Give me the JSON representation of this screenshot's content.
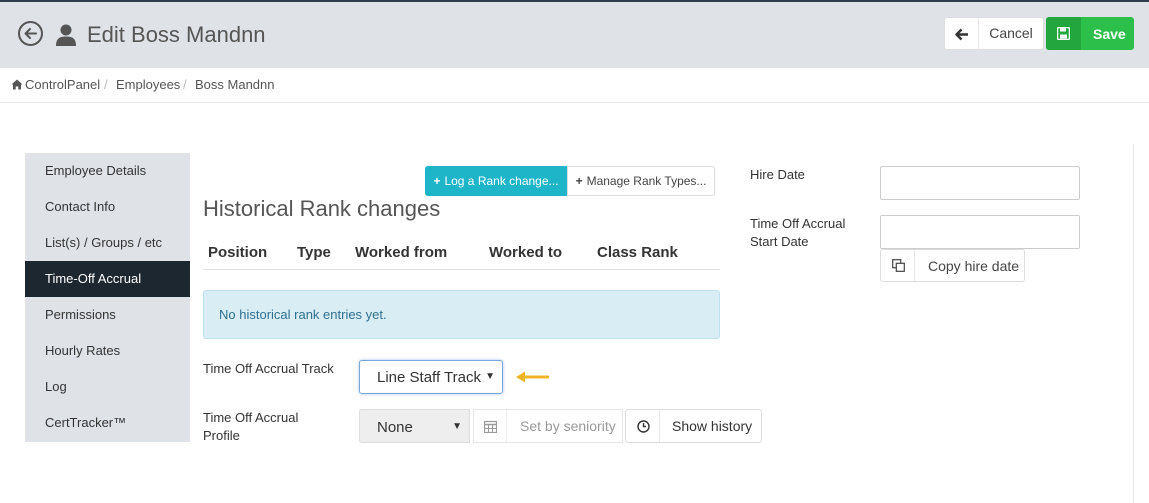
{
  "header": {
    "title": "Edit Boss Mandnn",
    "cancel_label": "Cancel",
    "save_label": "Save"
  },
  "breadcrumb": [
    "ControlPanel",
    "Employees",
    "Boss Mandnn"
  ],
  "sidebar": {
    "items": [
      {
        "label": "Employee Details",
        "active": false
      },
      {
        "label": "Contact Info",
        "active": false
      },
      {
        "label": "List(s) / Groups / etc",
        "active": false
      },
      {
        "label": "Time-Off Accrual",
        "active": true
      },
      {
        "label": "Permissions",
        "active": false
      },
      {
        "label": "Hourly Rates",
        "active": false
      },
      {
        "label": "Log",
        "active": false
      },
      {
        "label": "CertTracker™",
        "active": false
      }
    ]
  },
  "rank": {
    "log_button": "Log a Rank change...",
    "manage_button": "Manage Rank Types...",
    "section_title": "Historical Rank changes",
    "columns": [
      "Position",
      "Type",
      "Worked from",
      "Worked to",
      "Class Rank"
    ],
    "empty_message": "No historical rank entries yet."
  },
  "accrual": {
    "track_label": "Time Off Accrual Track",
    "track_value": "Line Staff Track",
    "profile_label_line1": "Time Off Accrual",
    "profile_label_line2": "Profile",
    "profile_value": "None",
    "seniority_button": "Set by seniority",
    "history_button": "Show history"
  },
  "dates": {
    "hire_date_label": "Hire Date",
    "hire_date_value": "",
    "start_label_line1": "Time Off Accrual",
    "start_label_line2": "Start Date",
    "start_date_value": "",
    "copy_button": "Copy hire date"
  },
  "colors": {
    "header_bg": "#dfe3e7",
    "save_green": "#2cbf4a",
    "info_cyan": "#1fb5c9",
    "sidebar_active": "#1d2730",
    "alert_bg": "#d9edf5",
    "hint_arrow": "#f0b429"
  }
}
